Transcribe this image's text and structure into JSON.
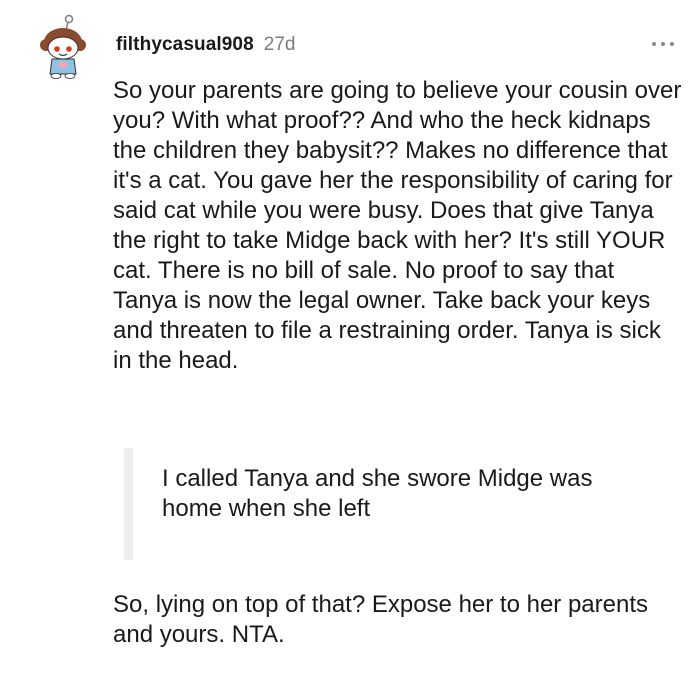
{
  "comment": {
    "username": "filthycasual908",
    "timestamp": "27d",
    "avatar_icon": "snoo-avatar-icon",
    "more_icon": "more-options-icon",
    "paragraph_1": "So your parents are going to believe your cousin over you? With what proof?? And who the heck kidnaps the children they babysit?? Makes no difference that it's a cat. You gave her the responsibility of caring for said cat while you were busy. Does that give Tanya the right to take Midge back with her? It's still YOUR cat. There is no bill of sale. No proof to say that Tanya is now the legal owner. Take back your keys and threaten to file a restraining order. Tanya is sick in the head.",
    "quote": "I called Tanya and she swore Midge was home when she left",
    "paragraph_2": "So, lying on top of that? Expose her to her parents and yours. NTA."
  },
  "colors": {
    "text": "#1a1a1b",
    "meta": "#7c7c7c",
    "quote_bar": "#edeff1"
  }
}
